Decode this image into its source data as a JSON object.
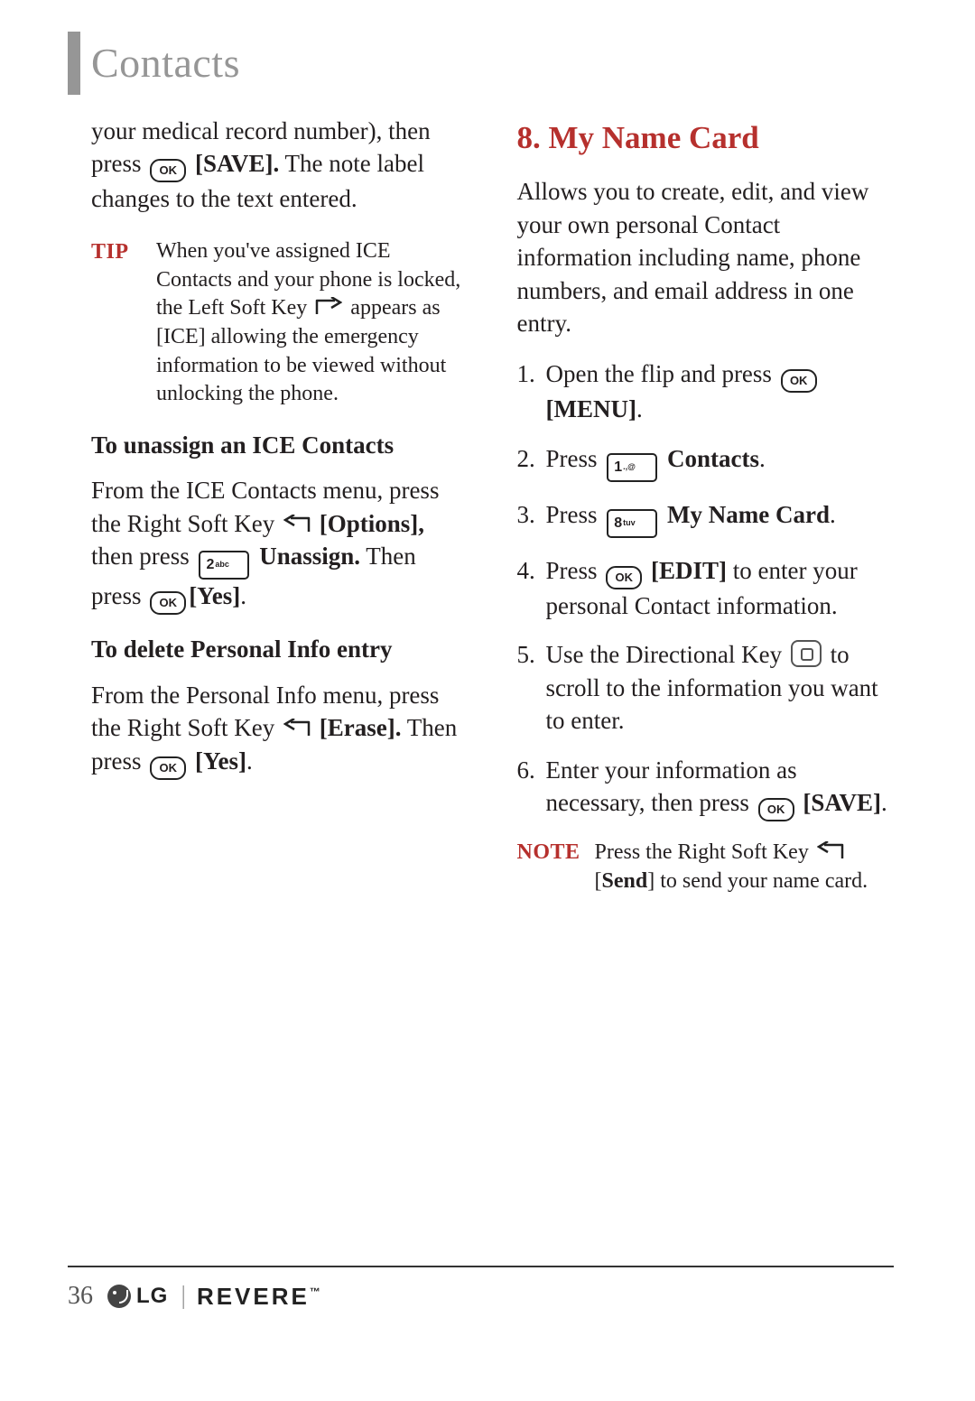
{
  "chapter": "Contacts",
  "left": {
    "lead_in_1": "your medical record number), then press ",
    "lead_in_save": "[SAVE].",
    "lead_in_2": " The note label changes to the text entered.",
    "tip_label": "TIP",
    "tip_1": "When you've assigned ICE Contacts and your phone is locked, the Left Soft Key ",
    "tip_2": " appears as [ICE] allowing the emergency information to be viewed without unlocking the phone.",
    "subhead_unassign": "To unassign an ICE Contacts",
    "unassign_1": "From the ICE Contacts menu, press the Right Soft Key ",
    "unassign_options": "[Options],",
    "unassign_2": " then press ",
    "unassign_label": "Unassign.",
    "unassign_3": " Then press ",
    "unassign_yes": "[Yes]",
    "subhead_delete": "To delete Personal Info entry",
    "delete_1": "From the Personal Info menu, press the Right Soft Key ",
    "delete_erase": "[Erase].",
    "delete_2": " Then press ",
    "delete_yes": "[Yes]"
  },
  "right": {
    "section_title": "8. My Name Card",
    "intro": "Allows you to create, edit, and view your own personal Contact information including name, phone numbers, and email address in one entry.",
    "s1_a": "Open the flip and press ",
    "s1_menu": "[MENU]",
    "s2_a": "Press ",
    "s2_contacts": "Contacts",
    "s3_a": "Press ",
    "s3_card": "My Name Card",
    "s4_a": "Press ",
    "s4_edit": "[EDIT]",
    "s4_b": " to enter your personal Contact information.",
    "s5_a": "Use the Directional Key ",
    "s5_b": " to scroll to the information you want to enter.",
    "s6_a": "Enter your information as necessary, then press ",
    "s6_save": "[SAVE]",
    "note_label": "NOTE",
    "note_1": "Press the Right Soft Key ",
    "note_send": "Send",
    "note_2": "] to send your name card."
  },
  "icons": {
    "ok": "OK",
    "key1": "1",
    "key1_sup": ".,@",
    "key2": "2",
    "key2_sup": "abc",
    "key8": "8",
    "key8_sup": "tuv"
  },
  "footer": {
    "page": "36",
    "brand_lg": "LG",
    "brand_revere": "REVERE",
    "tm": "™"
  }
}
